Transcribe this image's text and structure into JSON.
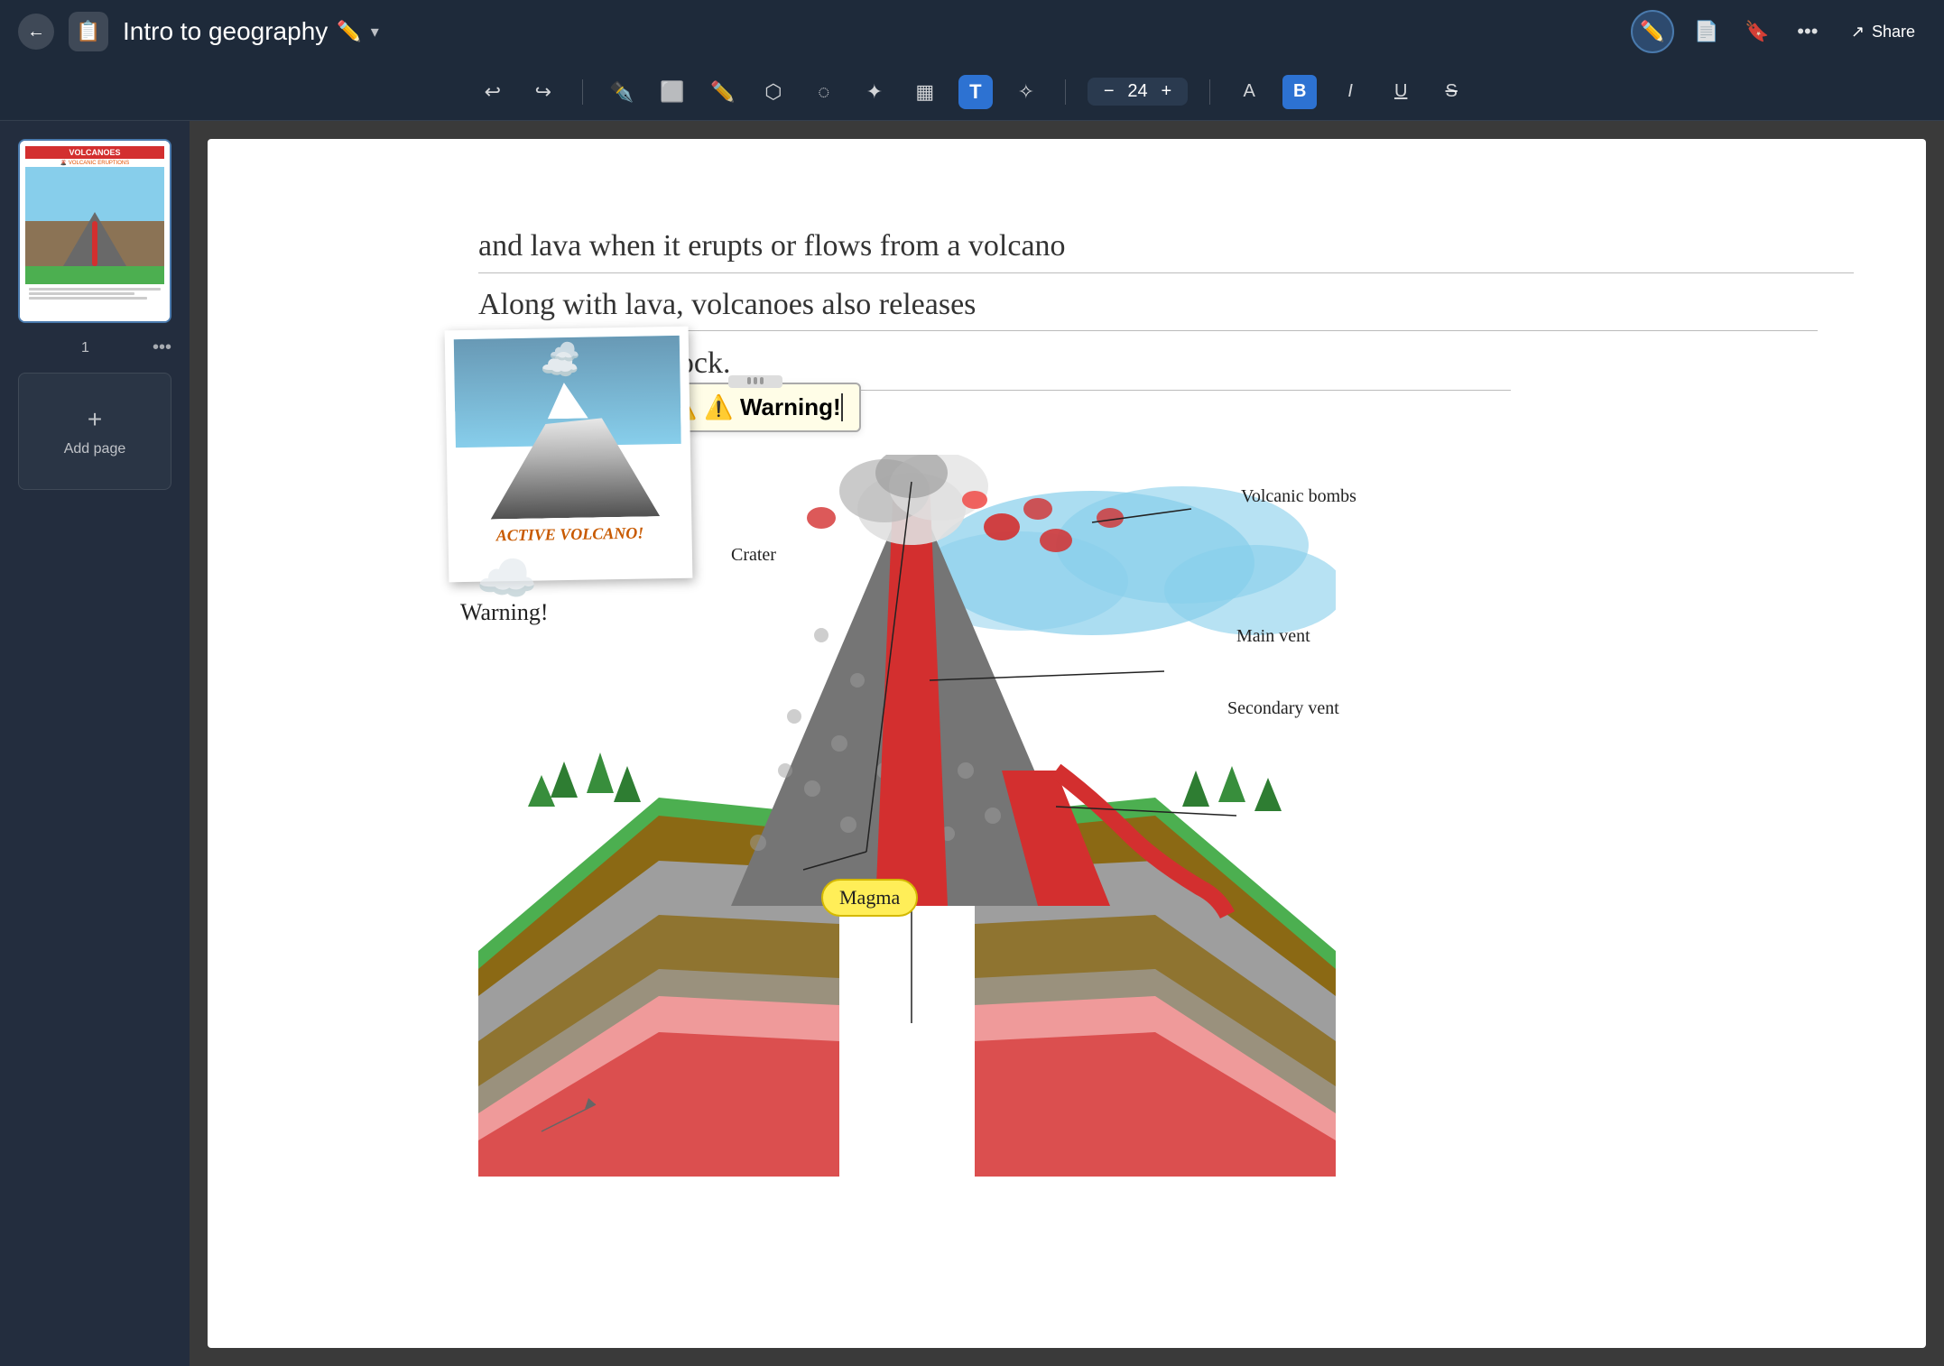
{
  "header": {
    "title": "Intro to geography",
    "pencil_emoji": "✏️",
    "back_label": "←",
    "share_label": "Share",
    "more_label": "•••"
  },
  "toolbar": {
    "undo_label": "↩",
    "redo_label": "↪",
    "pen_label": "✏",
    "eraser_label": "◻",
    "highlighter_label": "✏",
    "lasso_label": "⬡",
    "selection_label": "◌",
    "star_label": "✦",
    "image_label": "▦",
    "text_label": "T",
    "magic_label": "✧",
    "minus_label": "−",
    "font_size": "24",
    "plus_label": "+",
    "font_a_label": "A",
    "bold_label": "B",
    "italic_label": "I",
    "underline_label": "U",
    "strikethrough_label": "S"
  },
  "sidebar": {
    "page_number": "1",
    "dots_label": "•••",
    "add_page_label": "Add page",
    "plus_label": "+"
  },
  "canvas": {
    "text_line1": "and lava when it erupts or flows from a volcano",
    "text_line2": "Along with lava, volcanoes also releases",
    "text_line3": "gases, ash, and rock.",
    "warning_box_text": "⚠️ Warning!",
    "photo_caption": "ACTIVE VOLCANO!",
    "warning_footer": "Warning!",
    "labels": {
      "volcanic_bombs": "Volcanic bombs",
      "crater": "Crater",
      "main_vent": "Main vent",
      "secondary_vent": "Secondary vent",
      "magma": "Magma"
    },
    "thumb_title": "VOLCANOES",
    "thumb_subtitle": "🌋 VOLCANIC ERUPTIONS"
  }
}
